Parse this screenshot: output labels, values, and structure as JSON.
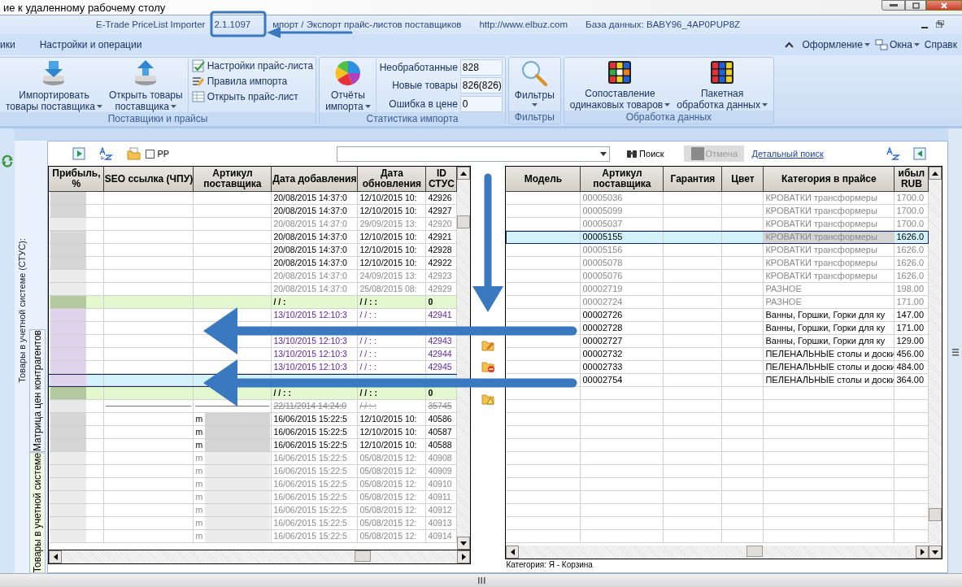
{
  "remote_title": "ие к удаленному рабочему столу",
  "app_title": {
    "name": "E-Trade PriceList Importer",
    "version": "2.1.1097",
    "subtitle": "мпорт / Экспорт прайс-листов поставщиков",
    "url": "http://www.elbuz.com",
    "database": "База данных: BABY96_4AP0PUP8Z"
  },
  "menu": {
    "left": [
      {
        "label": "ики",
        "selected": false
      },
      {
        "label": "Настройки и операции",
        "selected": false
      }
    ],
    "right": [
      {
        "label": "Оформление",
        "dropdown": true
      },
      {
        "label": "Окна",
        "dropdown": true
      },
      {
        "label": "Справк",
        "dropdown": false
      }
    ]
  },
  "ribbon": [
    {
      "title": "Поставщики и прайсы",
      "items": [
        {
          "kind": "large",
          "lines": [
            "Импортировать",
            "товары поставщика"
          ],
          "dropdown": true
        },
        {
          "kind": "large",
          "lines": [
            "Открыть товары",
            "поставщика"
          ],
          "dropdown": true
        },
        {
          "kind": "stack",
          "items": [
            {
              "label": "Настройки прайс-листа"
            },
            {
              "label": "Правила импорта"
            },
            {
              "label": "Открыть прайс-лист"
            }
          ]
        }
      ]
    },
    {
      "title": "Статистика импорта",
      "items": [
        {
          "kind": "large",
          "lines": [
            "Отчёты",
            "импорта"
          ],
          "dropdown": true
        },
        {
          "kind": "stats",
          "items": [
            {
              "label": "Необработанные",
              "value": "828"
            },
            {
              "label": "Новые товары",
              "value": "826(826)"
            },
            {
              "label": "Ошибка в цене",
              "value": "0"
            }
          ]
        }
      ]
    },
    {
      "title": "Фильтры",
      "items": [
        {
          "kind": "large",
          "lines": [
            "Фильтры"
          ],
          "dropdown": true
        }
      ]
    },
    {
      "title": "Обработка данных",
      "items": [
        {
          "kind": "large",
          "lines": [
            "Сопоставление",
            "одинаковых товаров"
          ],
          "dropdown": true
        },
        {
          "kind": "large",
          "lines": [
            "Пакетная",
            "обработка данных"
          ],
          "dropdown": true
        }
      ]
    }
  ],
  "toolbar": {
    "checkbox": {
      "label": "PP",
      "checked": false
    },
    "search_button": "Поиск",
    "cancel_button": {
      "label": "Отмена",
      "disabled": true
    },
    "detail_link": "Детальный поиск"
  },
  "side": {
    "caption": "Товары в учетной системе (СТУС):",
    "tabs": [
      {
        "label": "Матрица цен контрагентов",
        "selected": false
      },
      {
        "label": "Товары в учетной системе",
        "selected": true
      }
    ]
  },
  "left_grid": {
    "columns": [
      "Прибыль, %",
      "SEO ссылка (ЧПУ)",
      "Артикул поставщика",
      "Дата добавления",
      "Дата обновления",
      "ID СТУС"
    ],
    "rows": [
      {
        "kind": "active",
        "selected": false,
        "added": "20/08/2015 14:37:0",
        "updated": "12/10/2015 10:",
        "id": "42926"
      },
      {
        "kind": "active",
        "selected": false,
        "added": "20/08/2015 14:37:0",
        "updated": "12/10/2015 10:",
        "id": "42927"
      },
      {
        "kind": "inactive",
        "selected": false,
        "added": "20/08/2015 14:37:0",
        "updated": "29/09/2015 13:",
        "id": "42920"
      },
      {
        "kind": "active",
        "selected": false,
        "added": "20/08/2015 14:37:0",
        "updated": "12/10/2015 10:",
        "id": "42921"
      },
      {
        "kind": "active",
        "selected": false,
        "added": "20/08/2015 14:37:0",
        "updated": "12/10/2015 10:",
        "id": "42928"
      },
      {
        "kind": "active",
        "selected": false,
        "added": "20/08/2015 14:37:0",
        "updated": "12/10/2015 10:",
        "id": "42922"
      },
      {
        "kind": "inactive",
        "selected": false,
        "added": "20/08/2015 14:37:0",
        "updated": "24/09/2015 13:",
        "id": "42923"
      },
      {
        "kind": "inactive",
        "selected": false,
        "added": "20/08/2015 14:37:0",
        "updated": "25/08/2015 08:",
        "id": "42929"
      },
      {
        "kind": "group",
        "selected": false,
        "added": "/ /    :",
        "updated": "/ /    : :",
        "id": "0"
      },
      {
        "kind": "new",
        "selected": false,
        "added": "13/10/2015 12:10:3",
        "updated": "/ /    : :",
        "id": "42941"
      },
      {
        "kind": "new",
        "selected": false
      },
      {
        "kind": "new",
        "selected": false,
        "added": "13/10/2015 12:10:3",
        "updated": "/ /    : :",
        "id": "42943"
      },
      {
        "kind": "new",
        "selected": false,
        "added": "13/10/2015 12:10:3",
        "updated": "/ /    : :",
        "id": "42944"
      },
      {
        "kind": "new",
        "selected": false,
        "added": "13/10/2015 12:10:3",
        "updated": "/ /    : :",
        "id": "42945"
      },
      {
        "kind": "new",
        "selected": true
      },
      {
        "kind": "group",
        "selected": false,
        "added": "/ /    : :",
        "updated": "/ /    : :",
        "id": "0"
      },
      {
        "kind": "deleted",
        "selected": false,
        "added": "22/11/2014 14:24:0",
        "updated": "/ /    : :",
        "id": "35745"
      },
      {
        "kind": "active",
        "selected": false,
        "article": "m",
        "blurred": true,
        "added": "16/06/2015 15:22:5",
        "updated": "12/10/2015 10:",
        "id": "40586"
      },
      {
        "kind": "active",
        "selected": false,
        "article": "m",
        "blurred": true,
        "added": "16/06/2015 15:22:5",
        "updated": "12/10/2015 10:",
        "id": "40587"
      },
      {
        "kind": "active",
        "selected": false,
        "article": "m",
        "blurred": true,
        "added": "16/06/2015 15:22:5",
        "updated": "12/10/2015 10:",
        "id": "40588"
      },
      {
        "kind": "inactive",
        "selected": false,
        "article": "m",
        "blurred": true,
        "added": "16/06/2015 15:22:5",
        "updated": "05/08/2015 12:",
        "id": "40908"
      },
      {
        "kind": "inactive",
        "selected": false,
        "article": "m",
        "blurred": true,
        "added": "16/06/2015 15:22:5",
        "updated": "05/08/2015 12:",
        "id": "40909"
      },
      {
        "kind": "inactive",
        "selected": false,
        "article": "m",
        "blurred": true,
        "added": "16/06/2015 15:22:5",
        "updated": "05/08/2015 12:",
        "id": "40910"
      },
      {
        "kind": "inactive",
        "selected": false,
        "article": "m",
        "blurred": true,
        "added": "16/06/2015 15:22:5",
        "updated": "05/08/2015 12:",
        "id": "40911"
      },
      {
        "kind": "inactive",
        "selected": false,
        "article": "m",
        "blurred": true,
        "added": "16/06/2015 15:22:5",
        "updated": "05/08/2015 12:",
        "id": "40912"
      },
      {
        "kind": "inactive",
        "selected": false,
        "article": "m",
        "blurred": true,
        "added": "16/06/2015 15:22:5",
        "updated": "05/08/2015 12:",
        "id": "40913"
      },
      {
        "kind": "inactive",
        "selected": false,
        "article": "m",
        "blurred": true,
        "added": "16/06/2015 15:22:5",
        "updated": "05/08/2015 12:",
        "id": "40914"
      }
    ]
  },
  "right_grid": {
    "columns": [
      "Модель",
      "Артикул поставщика",
      "Гарантия",
      "Цвет",
      "Категория в прайсе",
      "ибыл RUB"
    ],
    "rows": [
      {
        "kind": "inactive",
        "selected": false,
        "article": "00005036",
        "category": "КРОВАТКИ трансформеры",
        "price": "1700.0"
      },
      {
        "kind": "inactive",
        "selected": false,
        "article": "00005099",
        "category": "КРОВАТКИ трансформеры",
        "price": "1700.0"
      },
      {
        "kind": "inactive",
        "selected": false,
        "article": "00005037",
        "category": "КРОВАТКИ трансформеры",
        "price": "1700.0"
      },
      {
        "kind": "active",
        "selected": true,
        "article": "00005155",
        "category": "КРОВАТКИ трансформеры",
        "price": "1626.0"
      },
      {
        "kind": "inactive",
        "selected": false,
        "article": "00005156",
        "category": "КРОВАТКИ трансформеры",
        "price": "1626.0"
      },
      {
        "kind": "inactive",
        "selected": false,
        "article": "00005078",
        "category": "КРОВАТКИ трансформеры",
        "price": "1626.0"
      },
      {
        "kind": "inactive",
        "selected": false,
        "article": "00005076",
        "category": "КРОВАТКИ трансформеры",
        "price": "1626.0"
      },
      {
        "kind": "inactive",
        "selected": false,
        "article": "00002719",
        "category": "РАЗНОЕ",
        "price": "198.00"
      },
      {
        "kind": "inactive",
        "selected": false,
        "article": "00002724",
        "category": "РАЗНОЕ",
        "price": "171.00"
      },
      {
        "kind": "active",
        "selected": false,
        "article": "00002726",
        "category": "Ванны, Горшки, Горки для ку",
        "price": "147.00"
      },
      {
        "kind": "active",
        "selected": false,
        "article": "00002728",
        "category": "Ванны, Горшки, Горки для ку",
        "price": "171.00"
      },
      {
        "kind": "active",
        "selected": false,
        "article": "00002727",
        "category": "Ванны, Горшки, Горки для ку",
        "price": "129.00"
      },
      {
        "kind": "active",
        "selected": false,
        "article": "00002732",
        "category": "ПЕЛЕНАЛЬНЫЕ столы и доски",
        "price": "456.00"
      },
      {
        "kind": "active",
        "selected": false,
        "article": "00002733",
        "category": "ПЕЛЕНАЛЬНЫЕ столы и доски",
        "price": "484.00"
      },
      {
        "kind": "active",
        "selected": false,
        "article": "00002754",
        "category": "ПЕЛЕНАЛЬНЫЕ столы и доски",
        "price": "364.00"
      }
    ],
    "footer": "Категория: Я - Корзина"
  }
}
